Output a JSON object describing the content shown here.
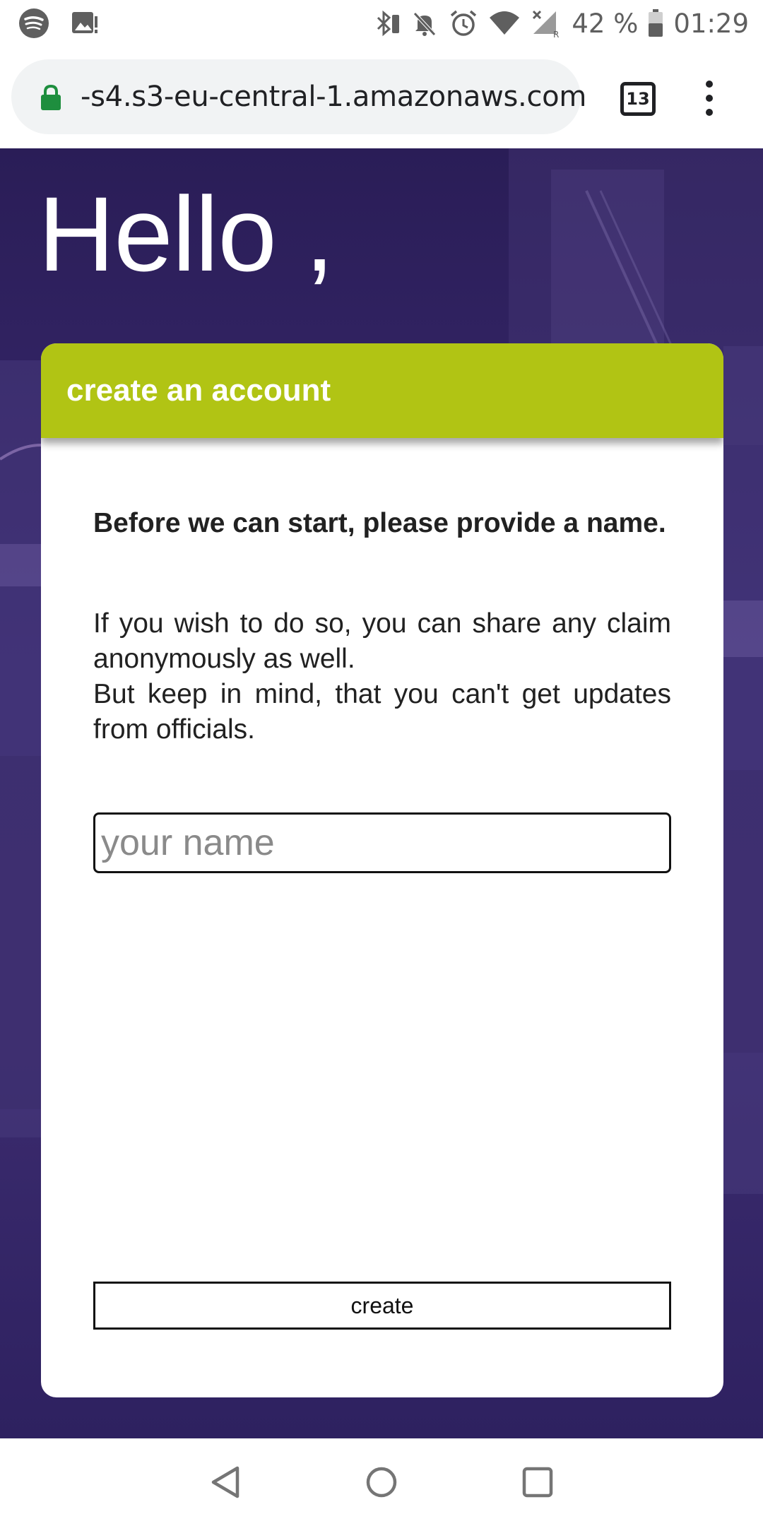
{
  "status_bar": {
    "battery_percent": "42 %",
    "time": "01:29",
    "left_icons": [
      "spotify-icon",
      "image-notification-icon"
    ],
    "right_icons": [
      "bluetooth-icon",
      "mute-icon",
      "alarm-icon",
      "wifi-icon",
      "signal-icon",
      "battery-icon"
    ]
  },
  "browser": {
    "url": "-s4.s3-eu-central-1.amazonaws.com",
    "tab_count": "13",
    "secure": true
  },
  "page": {
    "greeting": "Hello ,",
    "card": {
      "title": "create an account",
      "intro": "Before we can start, please provide a name.",
      "info_line1": "If you wish to do so, you can share any claim anonymously as well.",
      "info_line2": "But keep in mind, that you can't get updates from officials.",
      "name_placeholder": "your name",
      "name_value": "",
      "create_label": "create"
    }
  },
  "colors": {
    "header_green": "#b1c414",
    "background_purple": "#34265f",
    "card_white": "#ffffff",
    "secure_lock_green": "#1e8e3e"
  }
}
